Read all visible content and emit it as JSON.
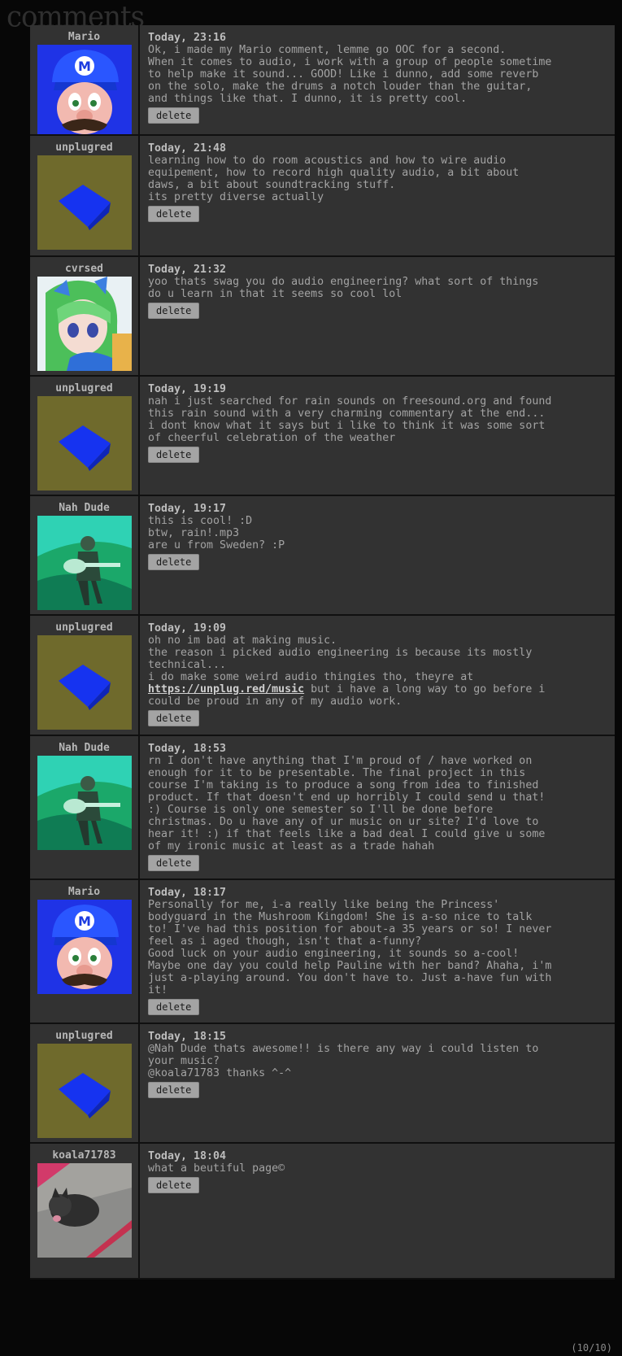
{
  "page": {
    "heading": "comments",
    "pagination": "(10/10)"
  },
  "delete_label": "delete",
  "colors": {
    "background": "#070707",
    "panel": "#323232",
    "text": "#a3a3a3",
    "button": "#a4a4a4",
    "olive": "#6f6a2c",
    "blue_cube": "#1633f0"
  },
  "comments": [
    {
      "author": "Mario",
      "avatar": "mario-avatar",
      "time": "Today, 23:16",
      "text": "Ok, i made my Mario comment, lemme go OOC for a second.\nWhen it comes to audio, i work with a group of people sometime\nto help make it sound... GOOD! Like i dunno, add some reverb\non the solo, make the drums a notch louder than the guitar,\nand things like that. I dunno, it is pretty cool."
    },
    {
      "author": "unplugred",
      "avatar": "blue-cube-avatar",
      "time": "Today, 21:48",
      "text": "learning how to do room acoustics and how to wire audio\nequipement, how to record high quality audio, a bit about\ndaws, a bit about soundtracking stuff.\nits pretty diverse actually"
    },
    {
      "author": "cvrsed",
      "avatar": "anime-girl-avatar",
      "time": "Today, 21:32",
      "text": "yoo thats swag you do audio engineering? what sort of things\ndo u learn in that it seems so cool lol"
    },
    {
      "author": "unplugred",
      "avatar": "blue-cube-avatar",
      "time": "Today, 19:19",
      "text": "nah i just searched for rain sounds on freesound.org and found\nthis rain sound with a very charming commentary at the end...\ni dont know what it says but i like to think it was some sort\nof cheerful celebration of the weather"
    },
    {
      "author": "Nah Dude",
      "avatar": "guitarist-avatar",
      "time": "Today, 19:17",
      "text": "this is cool! :D\nbtw, rain!.mp3\nare u from Sweden? :P"
    },
    {
      "author": "unplugred",
      "avatar": "blue-cube-avatar",
      "time": "Today, 19:09",
      "text_before": "oh no im bad at making music.\nthe reason i picked audio engineering is because its mostly\ntechnical...\ni do make some weird audio thingies tho, theyre at\n",
      "link": "https://unplug.red/music",
      "text_after": " but i have a long way to go before i\ncould be proud in any of my audio work."
    },
    {
      "author": "Nah Dude",
      "avatar": "guitarist-avatar",
      "time": "Today, 18:53",
      "text": "rn I don't have anything that I'm proud of / have worked on\nenough for it to be presentable. The final project in this\ncourse I'm taking is to produce a song from idea to finished\nproduct. If that doesn't end up horribly I could send u that!\n:) Course is only one semester so I'll be done before\nchristmas. Do u have any of ur music on ur site? I'd love to\nhear it! :) if that feels like a bad deal I could give u some\nof my ironic music at least as a trade hahah"
    },
    {
      "author": "Mario",
      "avatar": "mario-avatar",
      "time": "Today, 18:17",
      "text": "Personally for me, i-a really like being the Princess'\nbodyguard in the Mushroom Kingdom! She is a-so nice to talk\nto! I've had this position for about-a 35 years or so! I never\nfeel as i aged though, isn't that a-funny?\nGood luck on your audio engineering, it sounds so a-cool!\nMaybe one day you could help Pauline with her band? Ahaha, i'm\njust a-playing around. You don't have to. Just a-have fun with\nit!"
    },
    {
      "author": "unplugred",
      "avatar": "blue-cube-avatar",
      "time": "Today, 18:15",
      "text": "@Nah Dude thats awesome!! is there any way i could listen to\nyour music?\n@koala71783 thanks ^-^"
    },
    {
      "author": "koala71783",
      "avatar": "cat-photo-avatar",
      "time": "Today, 18:04",
      "text": "what a beutiful page©"
    }
  ]
}
